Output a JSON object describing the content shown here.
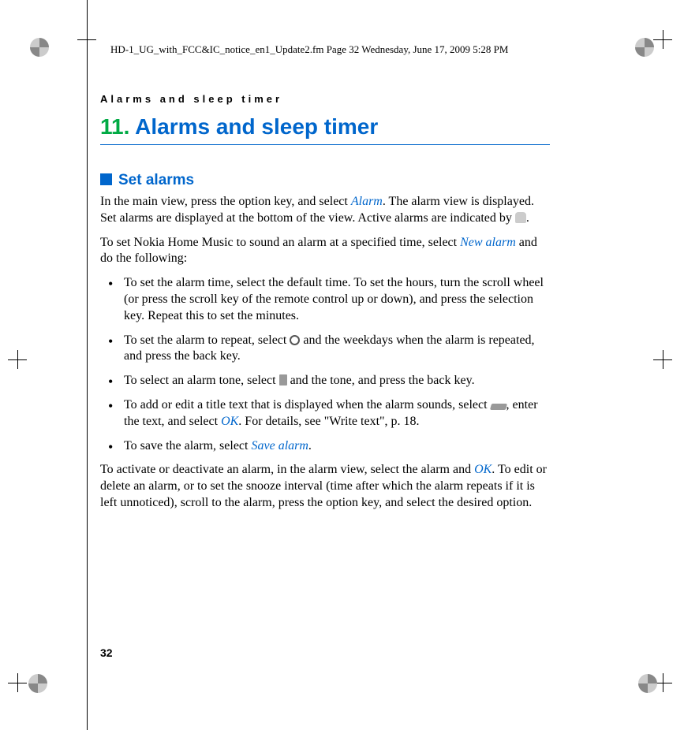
{
  "meta": {
    "header_line": "HD-1_UG_with_FCC&IC_notice_en1_Update2.fm  Page 32  Wednesday, June 17, 2009  5:28 PM",
    "running_head": "Alarms and sleep timer",
    "page_number": "32"
  },
  "chapter": {
    "number": "11.",
    "title": "Alarms and sleep timer"
  },
  "section": {
    "title": "Set alarms"
  },
  "paragraphs": {
    "p1_a": "In the main view, press the option key, and select ",
    "p1_link1": "Alarm",
    "p1_b": ". The alarm view is displayed. Set alarms are displayed at the bottom of the view. Active alarms are indicated by ",
    "p1_c": ".",
    "p2_a": "To set Nokia Home Music to sound an alarm at a specified time, select ",
    "p2_link1": "New alarm",
    "p2_b": " and do the following:",
    "p3_a": "To activate or deactivate an alarm, in the alarm view, select the alarm and ",
    "p3_link1": "OK",
    "p3_b": ". To edit or delete an alarm, or to set the snooze interval (time after which the alarm repeats if it is left unnoticed), scroll to the alarm, press the option key, and select the desired option."
  },
  "bullets": {
    "b1": "To set the alarm time, select the default time. To set the hours, turn the scroll wheel (or press the scroll key of the remote control up or down), and press the selection key. Repeat this to set the minutes.",
    "b2_a": "To set the alarm to repeat, select ",
    "b2_b": " and the weekdays when the alarm is repeated, and press the back key.",
    "b3_a": "To select an alarm tone, select ",
    "b3_b": " and the tone, and press the back key.",
    "b4_a": "To add or edit a title text that is displayed when the alarm sounds, select ",
    "b4_b": ", enter the text, and select ",
    "b4_link1": "OK",
    "b4_c": ". For details, see \"Write text\", p. 18.",
    "b5_a": "To save the alarm, select ",
    "b5_link1": "Save alarm",
    "b5_b": "."
  }
}
